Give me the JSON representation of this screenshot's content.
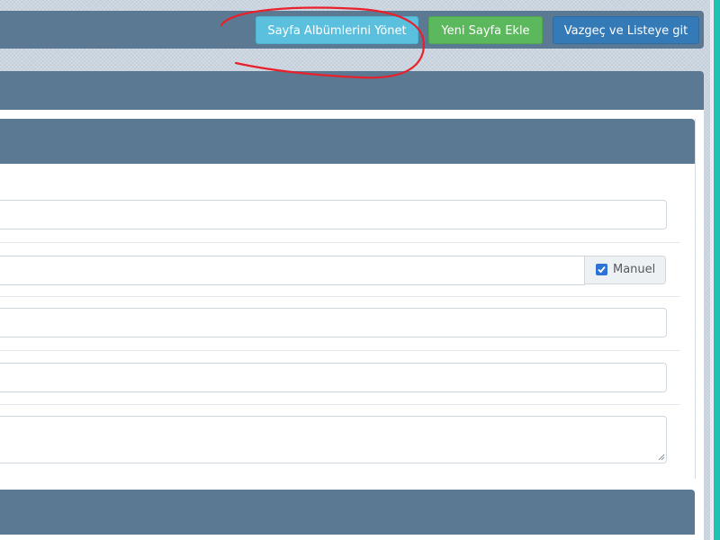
{
  "toolbar": {
    "manage_albums_label": "Sayfa Albümlerini Yönet",
    "add_page_label": "Yeni Sayfa Ekle",
    "cancel_label": "Vazgeç ve Listeye git"
  },
  "form": {
    "manual_label": "Manuel",
    "manual_checked": true
  },
  "colors": {
    "info": "#5bc0de",
    "success": "#5cb85c",
    "primary": "#337ab7",
    "panel_heading": "#5c7993",
    "annotation": "#e8202a"
  },
  "icons": {
    "checkbox": "checkbox-checked-icon",
    "resize": "textarea-resize-icon"
  }
}
